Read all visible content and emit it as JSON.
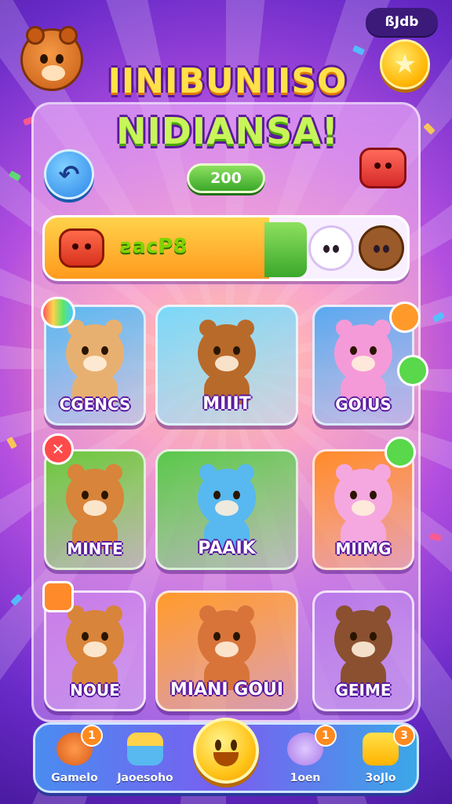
{
  "header": {
    "badge_text": "ßJdb",
    "title_line1": "IINIBUNIISO",
    "title_line2": "NIDIANSA!"
  },
  "score": {
    "value": "200"
  },
  "progress": {
    "label": "ƨacP8",
    "fraction": 0.62
  },
  "cards": [
    {
      "label": "CGENCS",
      "bg": "#5ab8f0",
      "critter_color": "#e8b070"
    },
    {
      "label": "MIIIT",
      "bg": "#7ad8f8",
      "critter_color": "#b86a2a"
    },
    {
      "label": "GOIUS",
      "bg": "#5aa8f0",
      "critter_color": "#f59ad8"
    },
    {
      "label": "MINTE",
      "bg": "#6ac83a",
      "critter_color": "#d8843a"
    },
    {
      "label": "PAAIK",
      "bg": "#58c84a",
      "critter_color": "#58b8f0"
    },
    {
      "label": "MIIMG",
      "bg": "#ff8a2a",
      "critter_color": "#f5a8e0"
    },
    {
      "label": "NOUE",
      "bg": "#c87ae8",
      "critter_color": "#d8843a"
    },
    {
      "label": "MIANI GOUI",
      "bg": "#ff9a2a",
      "critter_color": "#d8743a"
    },
    {
      "label": "GEIME",
      "bg": "#b878e8",
      "critter_color": "#8a5030"
    }
  ],
  "nav": {
    "items": [
      {
        "label": "Gamelo",
        "count": "1"
      },
      {
        "label": "Jaoesoho",
        "count": ""
      },
      {
        "label": "1oen",
        "count": "1"
      },
      {
        "label": "3oJlo",
        "count": "3"
      }
    ]
  },
  "icons": {
    "top_right": "star-icon",
    "back": "back-arrow-icon",
    "close": "close-icon"
  }
}
